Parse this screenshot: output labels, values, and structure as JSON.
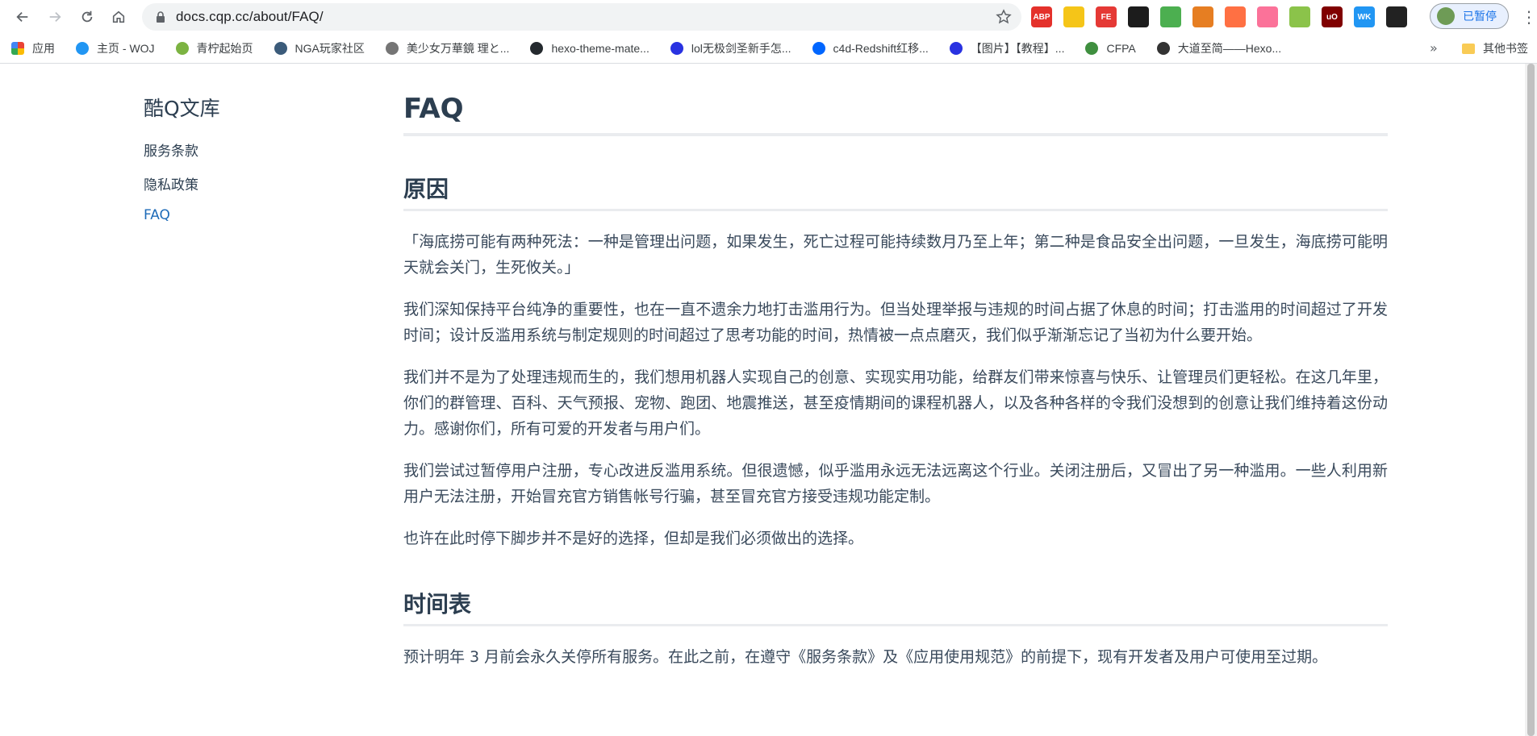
{
  "browser": {
    "url": "docs.cqp.cc/about/FAQ/",
    "profile_label": "已暂停",
    "extensions": [
      {
        "name": "adblock-plus-icon",
        "label": "ABP",
        "color": "#e4312b"
      },
      {
        "name": "piano-icon",
        "label": "",
        "color": "#f5c518"
      },
      {
        "name": "fe-helper-icon",
        "label": "FE",
        "color": "#e53935"
      },
      {
        "name": "tampermonkey-icon",
        "label": "",
        "color": "#1c1c1c"
      },
      {
        "name": "globe-plant-icon",
        "label": "",
        "color": "#4caf50"
      },
      {
        "name": "feather-icon",
        "label": "",
        "color": "#e67e22"
      },
      {
        "name": "blob-icon",
        "label": "",
        "color": "#ff7043"
      },
      {
        "name": "bilibili-icon",
        "label": "",
        "color": "#fb7299"
      },
      {
        "name": "circle-icon",
        "label": "",
        "color": "#8bc34a"
      },
      {
        "name": "ublock-icon",
        "label": "uO",
        "color": "#800000"
      },
      {
        "name": "wk-icon",
        "label": "WK",
        "color": "#2196f3"
      },
      {
        "name": "record-icon",
        "label": "",
        "color": "#222222"
      }
    ]
  },
  "bookmarks": [
    {
      "label": "应用",
      "icon": "apps-grid-icon",
      "color": "#ea4335"
    },
    {
      "label": "主页 - WOJ",
      "icon": "woj-icon",
      "color": "#2196f3"
    },
    {
      "label": "青柠起始页",
      "icon": "lime-icon",
      "color": "#7cb342"
    },
    {
      "label": "NGA玩家社区",
      "icon": "nga-icon",
      "color": "#3b5b7a"
    },
    {
      "label": "美少女万華鏡 理と...",
      "icon": "globe-icon",
      "color": "#757575"
    },
    {
      "label": "hexo-theme-mate...",
      "icon": "github-icon",
      "color": "#24292e"
    },
    {
      "label": "lol无极剑圣新手怎...",
      "icon": "baidu-icon",
      "color": "#2932e1"
    },
    {
      "label": "c4d-Redshift红移...",
      "icon": "zhihu-icon",
      "color": "#0066ff"
    },
    {
      "label": "【图片】【教程】...",
      "icon": "baidu-icon",
      "color": "#2932e1"
    },
    {
      "label": "CFPA",
      "icon": "earth-icon",
      "color": "#3f8f3f"
    },
    {
      "label": "大道至简——Hexo...",
      "icon": "hexo-icon",
      "color": "#333333"
    }
  ],
  "bookmarks_more": "»",
  "bookmarks_other": "其他书签",
  "sidebar": {
    "title": "酷Q文库",
    "links": [
      "服务条款",
      "隐私政策",
      "FAQ"
    ]
  },
  "content": {
    "title": "FAQ",
    "section1_heading": "原因",
    "section1_paragraphs": [
      "「海底捞可能有两种死法：一种是管理出问题，如果发生，死亡过程可能持续数月乃至上年；第二种是食品安全出问题，一旦发生，海底捞可能明天就会关门，生死攸关。」",
      "我们深知保持平台纯净的重要性，也在一直不遗余力地打击滥用行为。但当处理举报与违规的时间占据了休息的时间；打击滥用的时间超过了开发时间；设计反滥用系统与制定规则的时间超过了思考功能的时间，热情被一点点磨灭，我们似乎渐渐忘记了当初为什么要开始。",
      "我们并不是为了处理违规而生的，我们想用机器人实现自己的创意、实现实用功能，给群友们带来惊喜与快乐、让管理员们更轻松。在这几年里，你们的群管理、百科、天气预报、宠物、跑团、地震推送，甚至疫情期间的课程机器人，以及各种各样的令我们没想到的创意让我们维持着这份动力。感谢你们，所有可爱的开发者与用户们。",
      "我们尝试过暂停用户注册，专心改进反滥用系统。但很遗憾，似乎滥用永远无法远离这个行业。关闭注册后，又冒出了另一种滥用。一些人利用新用户无法注册，开始冒充官方销售帐号行骗，甚至冒充官方接受违规功能定制。",
      "也许在此时停下脚步并不是好的选择，但却是我们必须做出的选择。"
    ],
    "section2_heading": "时间表",
    "section2_paragraphs": [
      "预计明年 3 月前会永久关停所有服务。在此之前，在遵守《服务条款》及《应用使用规范》的前提下，现有开发者及用户可使用至过期。"
    ]
  }
}
